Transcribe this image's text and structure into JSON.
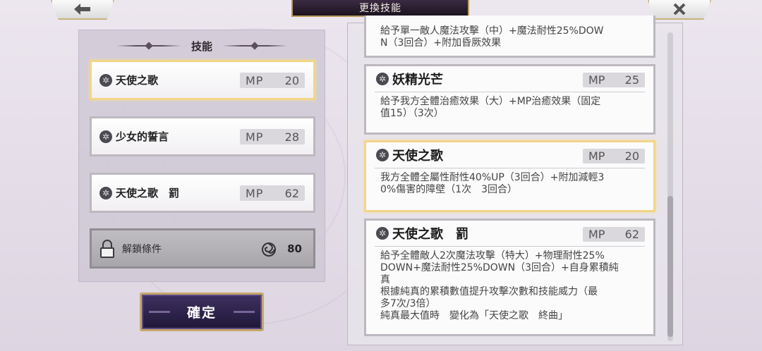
{
  "header": {
    "title": "更換技能"
  },
  "left": {
    "heading": "技能",
    "skills": [
      {
        "name": "天使之歌",
        "mp_label": "MP",
        "mp": "20"
      },
      {
        "name": "少女的誓言",
        "mp_label": "MP",
        "mp": "28"
      },
      {
        "name": "天使之歌　罰",
        "mp_label": "MP",
        "mp": "62"
      }
    ],
    "unlock": {
      "label": "解鎖條件",
      "value": "80"
    },
    "confirm_label": "確定"
  },
  "details": [
    {
      "name": "",
      "mp_label": "",
      "mp": "",
      "desc": "給予單一敵人魔法攻擊（中）+魔法耐性25%DOW\nN（3回合）+附加昏厥效果"
    },
    {
      "name": "妖精光芒",
      "mp_label": "MP",
      "mp": "25",
      "desc": "給予我方全體治癒效果（大）+MP治癒效果（固定\n值15）（3次）"
    },
    {
      "name": "天使之歌",
      "mp_label": "MP",
      "mp": "20",
      "desc": "我方全體全屬性耐性40%UP（3回合）+附加減輕3\n0%傷害的障壁（1次　3回合）"
    },
    {
      "name": "天使之歌　罰",
      "mp_label": "MP",
      "mp": "62",
      "desc": "給予全體敵人2次魔法攻擊（特大）+物理耐性25%\nDOWN+魔法耐性25%DOWN（3回合）+自身累積純\n真\n根據純真的累積數值提升攻擊次數和技能威力（最\n多7次/3倍）\n純真最大值時　變化為「天使之歌　終曲」"
    }
  ],
  "icons": {
    "back": "back-arrow-icon",
    "close": "close-icon",
    "skill": "gear-icon",
    "lock": "lock-icon",
    "purity": "spiral-icon"
  },
  "colors": {
    "selected_border": "#f2d587",
    "confirm_bg": "#2a2048",
    "title_bg": "#2a1f30"
  }
}
